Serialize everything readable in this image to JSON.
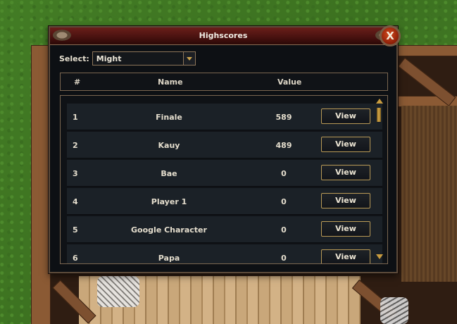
{
  "window": {
    "title": "Highscores",
    "close_label": "X"
  },
  "filter": {
    "label": "Select:",
    "selected": "Might"
  },
  "table": {
    "headers": {
      "rank": "#",
      "name": "Name",
      "value": "Value"
    },
    "rows": [
      {
        "rank": "1",
        "name": "Finale",
        "value": "589",
        "action": "View"
      },
      {
        "rank": "2",
        "name": "Kauy",
        "value": "489",
        "action": "View"
      },
      {
        "rank": "3",
        "name": "Bae",
        "value": "0",
        "action": "View"
      },
      {
        "rank": "4",
        "name": "Player 1",
        "value": "0",
        "action": "View"
      },
      {
        "rank": "5",
        "name": "Google Character",
        "value": "0",
        "action": "View"
      },
      {
        "rank": "6",
        "name": "Papa",
        "value": "0",
        "action": "View"
      }
    ]
  },
  "colors": {
    "title_bar": "#4a1210",
    "accent_gold": "#b99a56",
    "row_bg": "#1b2127",
    "panel_bg": "#0d1014"
  }
}
